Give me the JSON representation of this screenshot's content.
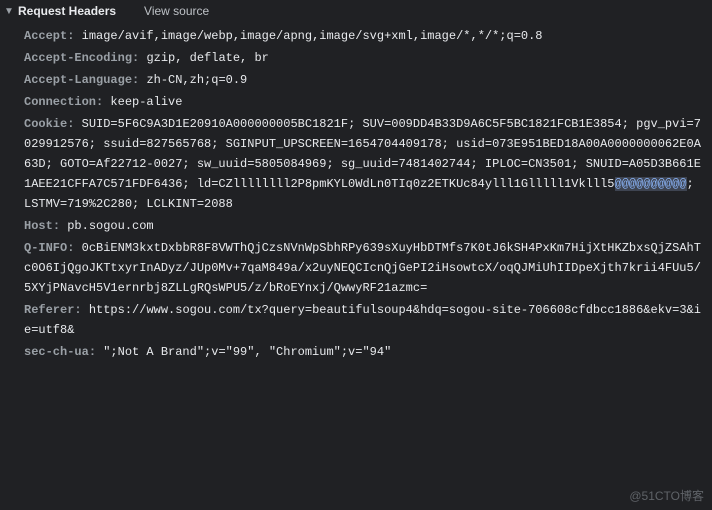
{
  "section_title": "Request Headers",
  "view_source_label": "View source",
  "watermark": "@51CTO博客",
  "headers": [
    {
      "name": "Accept",
      "value": "image/avif,image/webp,image/apng,image/svg+xml,image/*,*/*;q=0.8"
    },
    {
      "name": "Accept-Encoding",
      "value": "gzip, deflate, br"
    },
    {
      "name": "Accept-Language",
      "value": "zh-CN,zh;q=0.9"
    },
    {
      "name": "Connection",
      "value": "keep-alive"
    },
    {
      "name": "Cookie",
      "value": "SUID=5F6C9A3D1E20910A000000005BC1821F; SUV=009DD4B33D9A6C5F5BC1821FCB1E3854; pgv_pvi=7029912576; ssuid=827565768; SGINPUT_UPSCREEN=1654704409178; usid=073E951BED18A00A0000000062E0A63D; GOTO=Af22712-0027; sw_uuid=5805084969; sg_uuid=7481402744; IPLOC=CN3501; SNUID=A05D3B661E1AEE21CFFA7C571FDF6436; ld=CZllllllll2P8pmKYL0WdLn0TIq0z2ETKUc84ylll1Glllll1Vklll5@@@@@@@@@@; LSTMV=719%2C280; LCLKINT=2088"
    },
    {
      "name": "Host",
      "value": "pb.sogou.com"
    },
    {
      "name": "Q-INFO",
      "value": "0cBiENM3kxtDxbbR8F8VWThQjCzsNVnWpSbhRPy639sXuyHbDTMfs7K0tJ6kSH4PxKm7HijXtHKZbxsQjZSAhTc0O6IjQgoJKTtxyrInADyz/JUp0Mv+7qaM849a/x2uyNEQCIcnQjGePI2iHsowtcX/oqQJMiUhIIDpeXjth7krii4FUu5/5XYjPNavcH5V1ernrbj8ZLLgRQsWPU5/z/bRoEYnxj/QwwyRF21azmc="
    },
    {
      "name": "Referer",
      "value": "https://www.sogou.com/tx?query=beautifulsoup4&hdq=sogou-site-706608cfdbcc1886&ekv=3&ie=utf8&"
    },
    {
      "name": "sec-ch-ua",
      "value": "\";Not A Brand\";v=\"99\", \"Chromium\";v=\"94\""
    }
  ]
}
